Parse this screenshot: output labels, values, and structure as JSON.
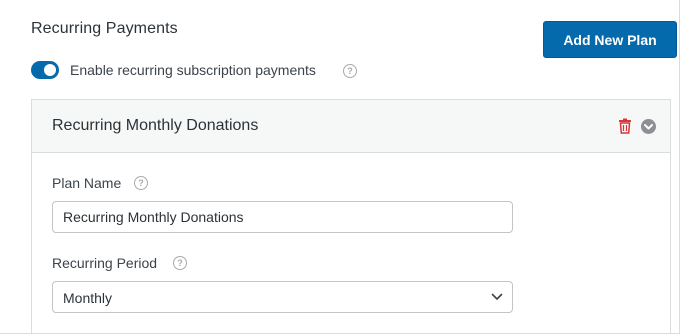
{
  "section": {
    "title": "Recurring Payments",
    "add_plan_label": "Add New Plan",
    "toggle_label": "Enable recurring subscription payments",
    "toggle_on": true,
    "help_glyph": "?"
  },
  "plan": {
    "header_title": "Recurring Monthly Donations",
    "plan_name_label": "Plan Name",
    "plan_name_value": "Recurring Monthly Donations",
    "period_label": "Recurring Period",
    "period_value": "Monthly"
  },
  "icons": {
    "help": "help-icon",
    "delete": "trash-icon",
    "collapse": "chevron-circle-icon",
    "dropdown": "chevron-down-icon"
  },
  "colors": {
    "accent": "#056aab",
    "delete": "#d63638",
    "header_bg": "#f6f7f7",
    "border": "#dcdcde"
  }
}
